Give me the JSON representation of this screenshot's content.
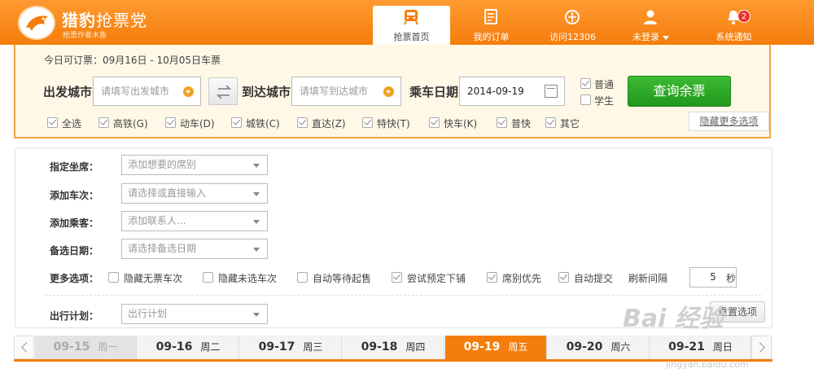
{
  "header": {
    "brand_main": "猎豹",
    "brand_sub": "抢票党",
    "tagline": "抢票作者木鱼",
    "nav": [
      {
        "label": "抢票首页",
        "icon": "train-icon",
        "active": true
      },
      {
        "label": "我的订单",
        "icon": "order-list-icon",
        "active": false
      },
      {
        "label": "访问12306",
        "icon": "globe-icon",
        "active": false
      },
      {
        "label": "未登录",
        "icon": "user-icon",
        "active": false
      },
      {
        "label": "系统通知",
        "icon": "bell-icon",
        "active": false
      }
    ],
    "notification_count": "2"
  },
  "search": {
    "available_text": "今日可订票：09月16日 - 10月05日车票",
    "from_label": "出发城市",
    "from_placeholder": "请填写出发城市",
    "to_label": "到达城市",
    "to_placeholder": "请填写到达城市",
    "date_label": "乘车日期",
    "date_value": "2014-09-19",
    "ticket_type_normal": "普通",
    "ticket_type_student": "学生",
    "query_button": "查询余票",
    "filters": [
      "全选",
      "高铁(G)",
      "动车(D)",
      "城铁(C)",
      "直达(Z)",
      "特快(T)",
      "快车(K)",
      "普快",
      "其它"
    ],
    "hide_more": "隐藏更多选项"
  },
  "options": {
    "seat_label": "指定坐席：",
    "seat_placeholder": "添加想要的席别",
    "train_label": "添加车次：",
    "train_placeholder": "请选择或直接输入",
    "passenger_label": "添加乘客：",
    "passenger_placeholder": "添加联系人...",
    "backup_date_label": "备选日期：",
    "backup_date_placeholder": "请选择备选日期",
    "more_label": "更多选项：",
    "more": [
      {
        "label": "隐藏无票车次",
        "checked": false
      },
      {
        "label": "隐藏未选车次",
        "checked": false
      },
      {
        "label": "自动等待起售",
        "checked": false
      },
      {
        "label": "尝试预定下铺",
        "checked": true
      },
      {
        "label": "席别优先",
        "checked": true
      },
      {
        "label": "自动提交",
        "checked": true
      }
    ],
    "refresh_label": "刷新间隔",
    "refresh_value": "5",
    "refresh_unit": "秒",
    "plan_label": "出行计划：",
    "plan_placeholder": "出行计划",
    "reset_button": "重置选项"
  },
  "datebar": [
    {
      "date": "09-15",
      "weekday": "周一",
      "state": "past"
    },
    {
      "date": "09-16",
      "weekday": "周二",
      "state": "normal"
    },
    {
      "date": "09-17",
      "weekday": "周三",
      "state": "normal"
    },
    {
      "date": "09-18",
      "weekday": "周四",
      "state": "normal"
    },
    {
      "date": "09-19",
      "weekday": "周五",
      "state": "active"
    },
    {
      "date": "09-20",
      "weekday": "周六",
      "state": "normal"
    },
    {
      "date": "09-21",
      "weekday": "周日",
      "state": "normal"
    }
  ],
  "watermark": {
    "text": "Bai 经验",
    "url": "jingyan.baidu.com"
  },
  "colors": {
    "accent": "#f57d0c",
    "query_green": "#2aa524",
    "panel_bg": "#fff8e7"
  }
}
